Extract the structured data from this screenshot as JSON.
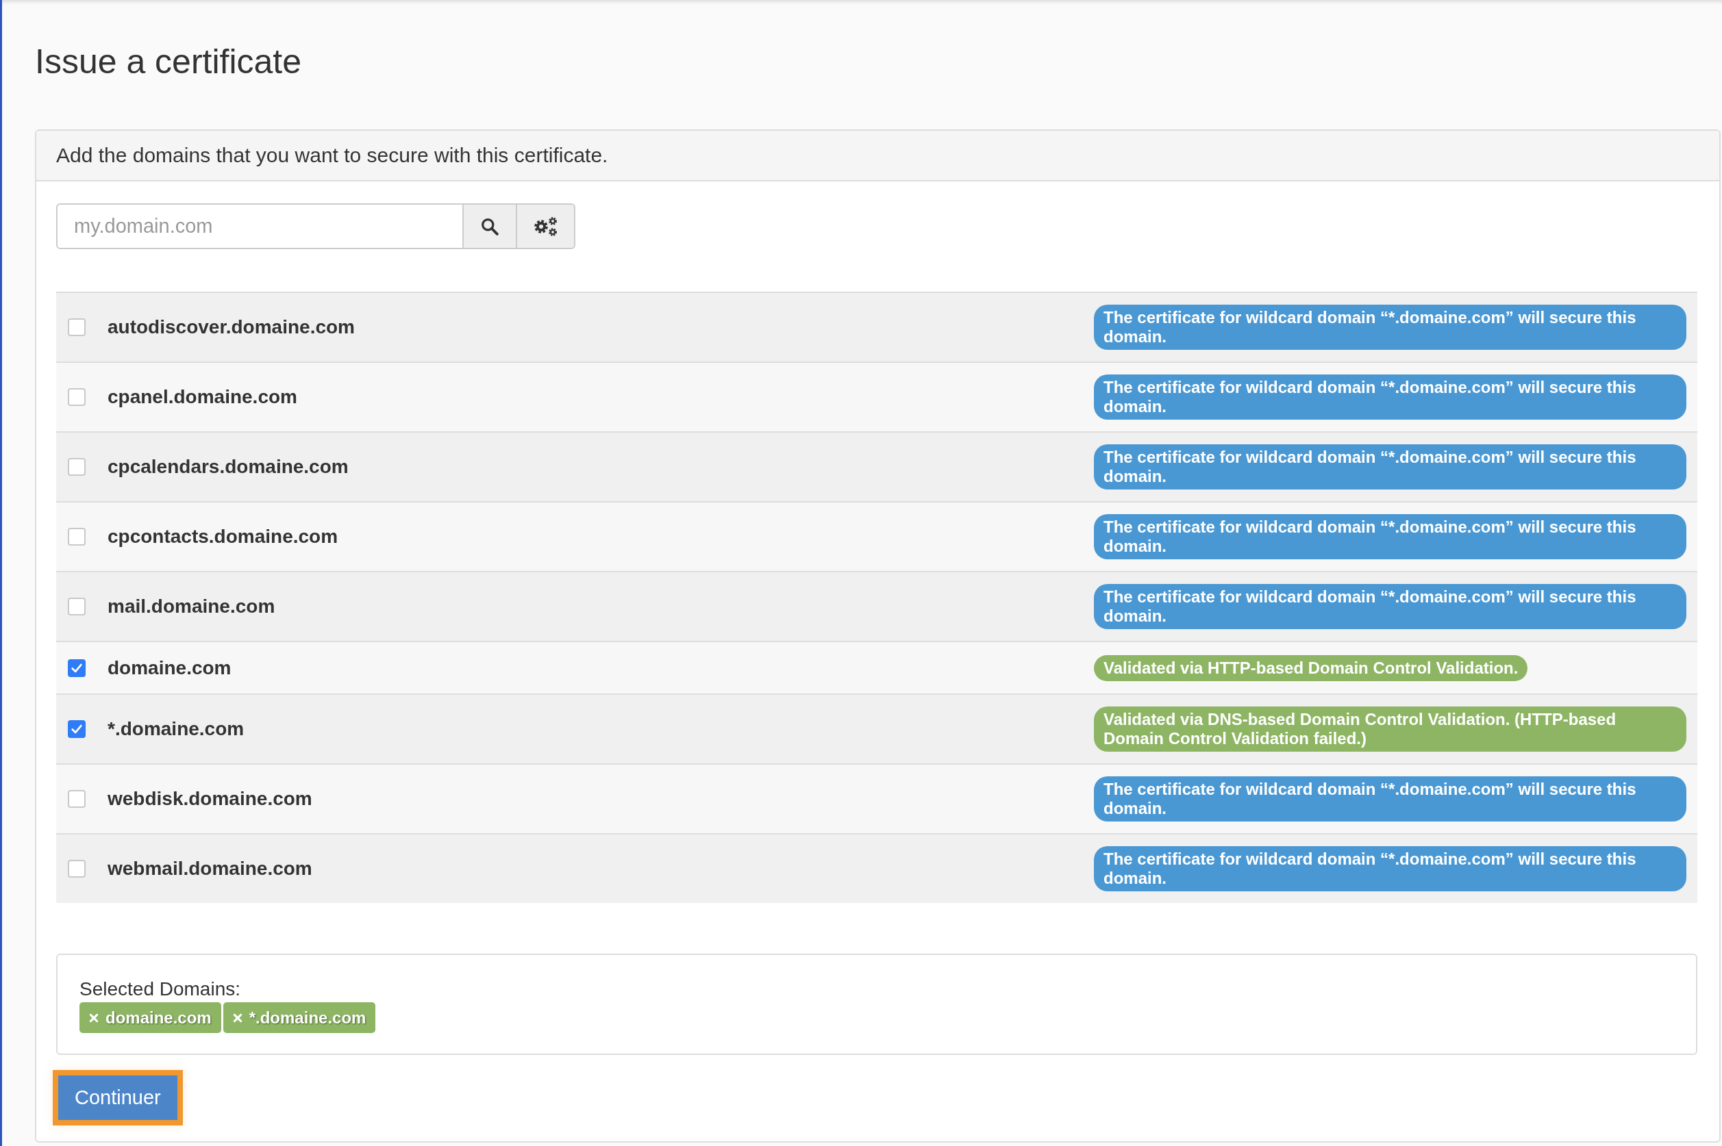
{
  "page_title": "Issue a certificate",
  "panel": {
    "heading": "Add the domains that you want to secure with this certificate.",
    "search": {
      "placeholder": "my.domain.com"
    },
    "domains": [
      {
        "name": "autodiscover.domaine.com",
        "checked": false,
        "note": {
          "kind": "info",
          "text": "The certificate for wildcard domain “*.domaine.com” will secure this domain."
        }
      },
      {
        "name": "cpanel.domaine.com",
        "checked": false,
        "note": {
          "kind": "info",
          "text": "The certificate for wildcard domain “*.domaine.com” will secure this domain."
        }
      },
      {
        "name": "cpcalendars.domaine.com",
        "checked": false,
        "note": {
          "kind": "info",
          "text": "The certificate for wildcard domain “*.domaine.com” will secure this domain."
        }
      },
      {
        "name": "cpcontacts.domaine.com",
        "checked": false,
        "note": {
          "kind": "info",
          "text": "The certificate for wildcard domain “*.domaine.com” will secure this domain."
        }
      },
      {
        "name": "mail.domaine.com",
        "checked": false,
        "note": {
          "kind": "info",
          "text": "The certificate for wildcard domain “*.domaine.com” will secure this domain."
        }
      },
      {
        "name": "domaine.com",
        "checked": true,
        "note": {
          "kind": "success",
          "text": "Validated via HTTP-based Domain Control Validation."
        }
      },
      {
        "name": "*.domaine.com",
        "checked": true,
        "note": {
          "kind": "success",
          "text": "Validated via DNS-based Domain Control Validation. (HTTP-based Domain Control Validation failed.)"
        }
      },
      {
        "name": "webdisk.domaine.com",
        "checked": false,
        "note": {
          "kind": "info",
          "text": "The certificate for wildcard domain “*.domaine.com” will secure this domain."
        }
      },
      {
        "name": "webmail.domaine.com",
        "checked": false,
        "note": {
          "kind": "info",
          "text": "The certificate for wildcard domain “*.domaine.com” will secure this domain."
        }
      }
    ],
    "selected_domains": {
      "label": "Selected Domains:",
      "tags": [
        "domaine.com",
        "*.domaine.com"
      ]
    },
    "continue_button": {
      "label": "Continuer",
      "focused": true
    }
  }
}
